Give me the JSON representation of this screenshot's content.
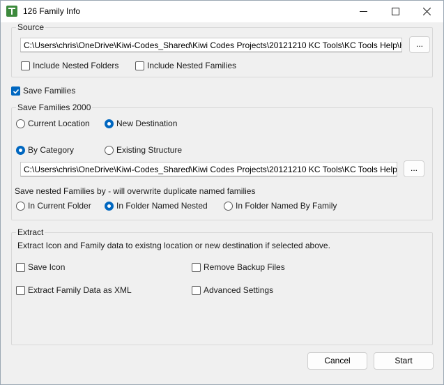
{
  "window": {
    "title": "126 Family Info",
    "icon": "app-logo-icon",
    "controls": [
      "minimize-icon",
      "maximize-icon",
      "close-icon"
    ]
  },
  "source": {
    "group_label": "Source",
    "path": "C:\\Users\\chris\\OneDrive\\Kiwi-Codes_Shared\\Kiwi Codes Projects\\20121210 KC Tools\\KC Tools Help\\Hel",
    "browse_label": "...",
    "include_nested_folders": {
      "label": "Include Nested Folders",
      "checked": false
    },
    "include_nested_families": {
      "label": "Include Nested Families",
      "checked": false
    }
  },
  "save_families": {
    "checkbox": {
      "label": "Save Families",
      "checked": true
    },
    "group_label": "Save Families 2000",
    "location": {
      "current_location": {
        "label": "Current Location",
        "selected": false
      },
      "new_destination": {
        "label": "New Destination",
        "selected": true
      }
    },
    "structure": {
      "by_category": {
        "label": "By Category",
        "selected": true
      },
      "existing_structure": {
        "label": "Existing Structure",
        "selected": false
      }
    },
    "destination_path": "C:\\Users\\chris\\OneDrive\\Kiwi-Codes_Shared\\Kiwi Codes Projects\\20121210 KC Tools\\KC Tools Help\\He",
    "browse_label": "...",
    "nested_label": "Save nested Families by - will overwrite duplicate named families",
    "nested": {
      "in_current_folder": {
        "label": "In Current Folder",
        "selected": false
      },
      "in_folder_named_nested": {
        "label": "In Folder Named Nested",
        "selected": true
      },
      "in_folder_named_by_family": {
        "label": "In Folder Named By Family",
        "selected": false
      }
    }
  },
  "extract": {
    "group_label": "Extract",
    "description": "Extract Icon and Family data to existng location or new destination if selected above.",
    "save_icon": {
      "label": "Save Icon",
      "checked": false
    },
    "remove_backup_files": {
      "label": "Remove Backup Files",
      "checked": false
    },
    "extract_xml": {
      "label": "Extract Family Data as XML",
      "checked": false
    },
    "advanced_settings": {
      "label": "Advanced Settings",
      "checked": false
    }
  },
  "footer": {
    "cancel_label": "Cancel",
    "start_label": "Start"
  },
  "colors": {
    "accent": "#0067c0",
    "window_bg": "#f0f0f0",
    "titlebar_bg": "#ffffff",
    "group_border": "#d8d8d8"
  }
}
